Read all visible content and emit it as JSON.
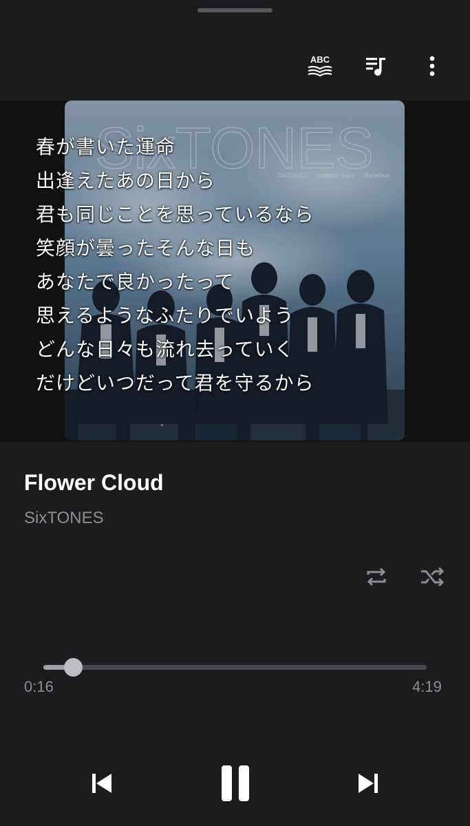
{
  "header": {
    "icons": [
      "lyrics-translate-icon",
      "queue-icon",
      "more-vert-icon"
    ]
  },
  "album": {
    "cover_text": "SixTONES",
    "cover_subtext_1": "SixTONES",
    "cover_subtext_2": "Imitation Rain",
    "cover_subtext_3": "Rebellion"
  },
  "lyrics": [
    "春が書いた運命",
    "出逢えたあの日から",
    "君も同じことを思っているなら",
    "笑顔が曇ったそんな日も",
    "あなたで良かったって",
    "思えるようなふたりでいよう",
    "どんな日々も流れ去っていく",
    "だけどいつだって君を守るから"
  ],
  "track": {
    "title": "Flower Cloud",
    "artist": "SixTONES"
  },
  "playback": {
    "elapsed": "0:16",
    "duration": "4:19",
    "progress_fraction": 0.0775,
    "state": "playing"
  },
  "colors": {
    "background": "#1c1c1e",
    "secondary_text": "#8e8e93"
  }
}
